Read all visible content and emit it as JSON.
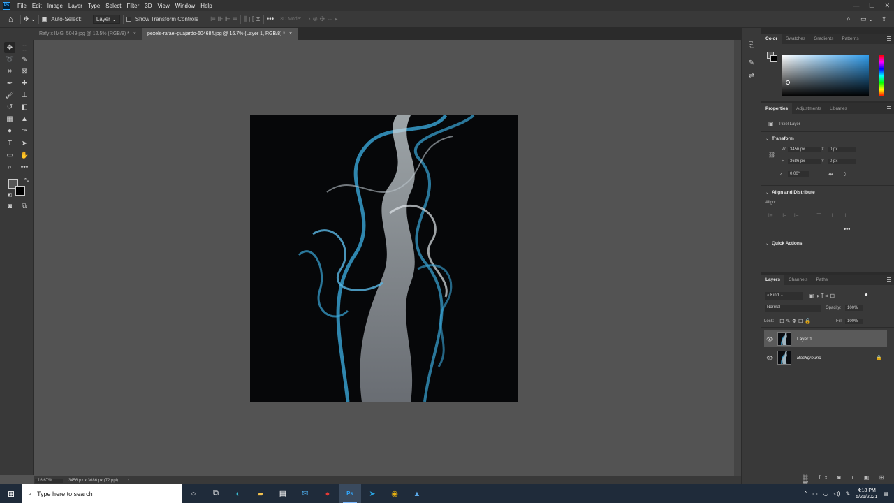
{
  "app": {
    "logo": "Ps",
    "menu": [
      "File",
      "Edit",
      "Image",
      "Layer",
      "Type",
      "Select",
      "Filter",
      "3D",
      "View",
      "Window",
      "Help"
    ],
    "window_controls": [
      "—",
      "❐",
      "✕"
    ]
  },
  "options": {
    "auto_select_label": "Auto-Select:",
    "auto_select_value": "Layer",
    "show_transform_label": "Show Transform Controls",
    "mode_3d_label": "3D Mode:"
  },
  "tabs": [
    {
      "label": "Rafy x IMG_5049.jpg @ 12.5% (RGB/8) *",
      "active": false
    },
    {
      "label": "pexels-rafael-guajardo-604684.jpg @ 16.7% (Layer 1, RGB/8) *",
      "active": true
    }
  ],
  "status": {
    "zoom": "16.67%",
    "doc_size": "3456 px x 3686 px (72 ppi)"
  },
  "color_panel": {
    "tabs": [
      "Color",
      "Swatches",
      "Gradients",
      "Patterns"
    ],
    "accent_hue": "#2f9bea"
  },
  "properties_panel": {
    "tabs": [
      "Properties",
      "Adjustments",
      "Libraries"
    ],
    "layer_type": "Pixel Layer",
    "transform_title": "Transform",
    "w_label": "W",
    "w_value": "3456 px",
    "h_label": "H",
    "h_value": "3686 px",
    "x_label": "X",
    "x_value": "0 px",
    "y_label": "Y",
    "y_value": "0 px",
    "angle_value": "0.00°",
    "align_title": "Align and Distribute",
    "align_label": "Align:",
    "quick_actions_title": "Quick Actions"
  },
  "layers_panel": {
    "tabs": [
      "Layers",
      "Channels",
      "Paths"
    ],
    "filter_kind": "Kind",
    "blend_mode": "Normal",
    "opacity_label": "Opacity:",
    "opacity_value": "100%",
    "lock_label": "Lock:",
    "fill_label": "Fill:",
    "fill_value": "100%",
    "layers": [
      {
        "name": "Layer 1",
        "selected": true,
        "locked": false
      },
      {
        "name": "Background",
        "selected": false,
        "locked": true
      }
    ]
  },
  "taskbar": {
    "search_placeholder": "Type here to search",
    "time": "4:18 PM",
    "date": "5/21/2021"
  }
}
